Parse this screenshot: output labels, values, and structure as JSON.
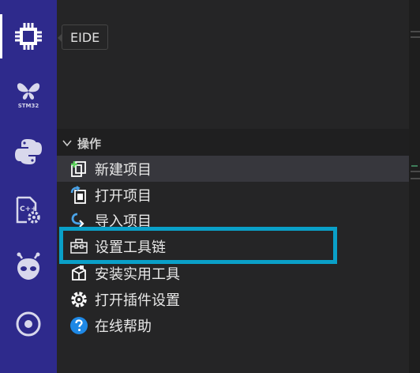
{
  "activity_bar": {
    "items": [
      {
        "name": "eide",
        "icon": "chip-icon"
      },
      {
        "name": "stm32",
        "icon": "butterfly-icon",
        "label": "STM32"
      },
      {
        "name": "python",
        "icon": "python-icon"
      },
      {
        "name": "cpp-settings",
        "icon": "cpp-file-gear-icon"
      },
      {
        "name": "platformio",
        "icon": "alien-icon"
      },
      {
        "name": "target",
        "icon": "target-icon"
      }
    ]
  },
  "tooltip": {
    "text": "EIDE"
  },
  "section": {
    "title": "操作"
  },
  "menu": {
    "items": [
      {
        "label": "新建项目",
        "icon": "new-project-icon"
      },
      {
        "label": "打开项目",
        "icon": "open-project-icon"
      },
      {
        "label": "导入项目",
        "icon": "import-project-icon"
      },
      {
        "label": "设置工具链",
        "icon": "toolbox-icon"
      },
      {
        "label": "安装实用工具",
        "icon": "install-package-icon"
      },
      {
        "label": "打开插件设置",
        "icon": "gear-icon"
      },
      {
        "label": "在线帮助",
        "icon": "help-icon"
      }
    ]
  },
  "colors": {
    "activity_bar": "#2e2a8c",
    "panel": "#252526",
    "highlight": "#0aa0c8",
    "hover": "#37373d"
  }
}
